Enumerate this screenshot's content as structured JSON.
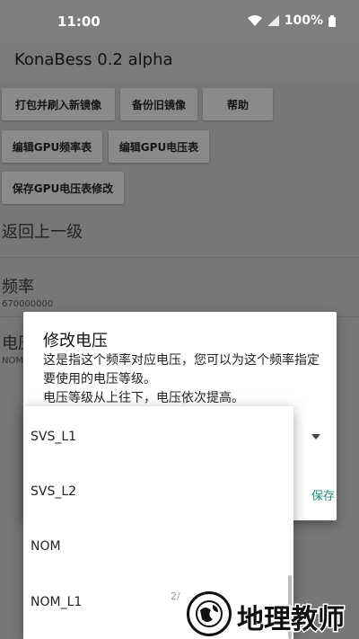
{
  "status_bar": {
    "time": "11:00",
    "battery": "100%"
  },
  "app_bar": {
    "title": "KonaBess 0.2 alpha"
  },
  "actions": {
    "flash_label": "打包并刷入新镜像",
    "backup_label": "备份旧镜像",
    "help_label": "帮助",
    "edit_freq_label": "编辑GPU频率表",
    "edit_volt_label": "编辑GPU电压表",
    "save_volt_label": "保存GPU电压表修改"
  },
  "list": {
    "back_label": "返回上一级",
    "freq_title": "频率",
    "freq_value": "670000000",
    "volt_title_partial": "电压",
    "volt_value_partial": "NOM"
  },
  "dialog": {
    "title": "修改电压",
    "message": "这是指这个频率对应电压，您可以为这个频率指定要使用的电压等级。\n电压等级从上往下，电压依次提高。",
    "save_partial": "保存"
  },
  "dropdown": {
    "options": [
      "SVS_L1",
      "SVS_L2",
      "NOM",
      "NOM_L1"
    ]
  },
  "watermark": {
    "text": "地理教师",
    "page_partial": "2/"
  }
}
